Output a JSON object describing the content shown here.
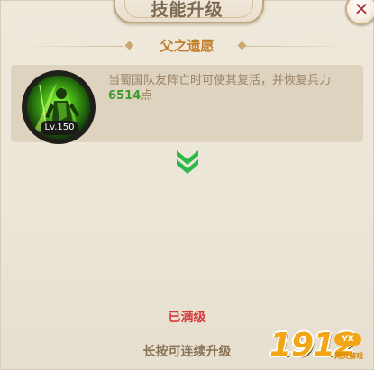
{
  "dialog": {
    "title": "技能升级",
    "close_icon": "close-x-icon",
    "close_glyph": "✕"
  },
  "skill": {
    "name": "父之遗愿",
    "level_label": "Lv.150",
    "icon": "green-warrior-portrait-icon",
    "description_before": "当蜀国队友阵亡时可使其复活，并恢复兵力",
    "description_value": "6514",
    "description_after": "点"
  },
  "indicator": {
    "icon": "double-chevron-down-icon"
  },
  "status": {
    "maxed_text": "已满级",
    "hint_text": "长按可连续升级"
  },
  "watermark": {
    "brand": "1912",
    "badge": "YX",
    "sub": "网页游戏"
  },
  "colors": {
    "accent_gold": "#c07d2c",
    "value_green": "#3e9a2c",
    "maxed_red": "#d83a3a",
    "chevron_green": "#2fb84a"
  }
}
